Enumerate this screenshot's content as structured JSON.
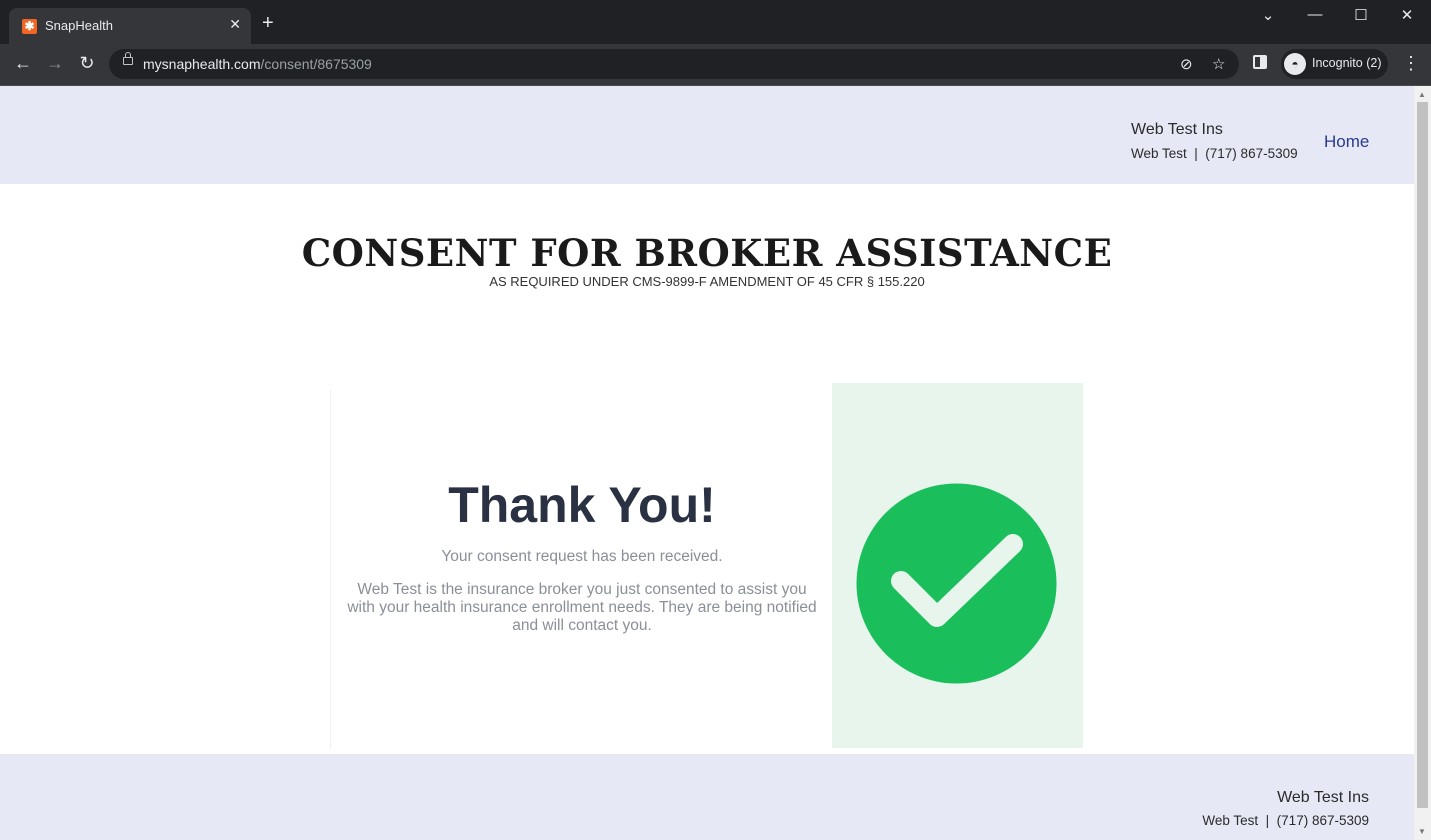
{
  "browser": {
    "tab_title": "SnapHealth",
    "tab_favicon": "snaphealth-asterisk",
    "url_domain": "mysnaphealth.com",
    "url_path": "/consent/8675309",
    "incognito_label": "Incognito (2)"
  },
  "header": {
    "org_name": "Web Test Ins",
    "contact": "Web Test  |  (717) 867-5309",
    "home_link": "Home"
  },
  "main": {
    "title": "CONSENT FOR BROKER ASSISTANCE",
    "subtitle": "AS REQUIRED UNDER CMS-9899-F AMENDMENT OF 45 CFR § 155.220",
    "thank_you": "Thank You!",
    "received": "Your consent request has been received.",
    "info": "Web Test is the insurance broker you just consented to assist you with your health insurance enrollment needs. They are being notified and will contact you."
  },
  "footer": {
    "org_name": "Web Test Ins",
    "contact": "Web Test  |  (717) 867-5309"
  },
  "colors": {
    "header_bg": "#e6e8f5",
    "check_green": "#1abf5c",
    "check_panel_bg": "#e8f5ec",
    "link": "#2a3a8f"
  }
}
